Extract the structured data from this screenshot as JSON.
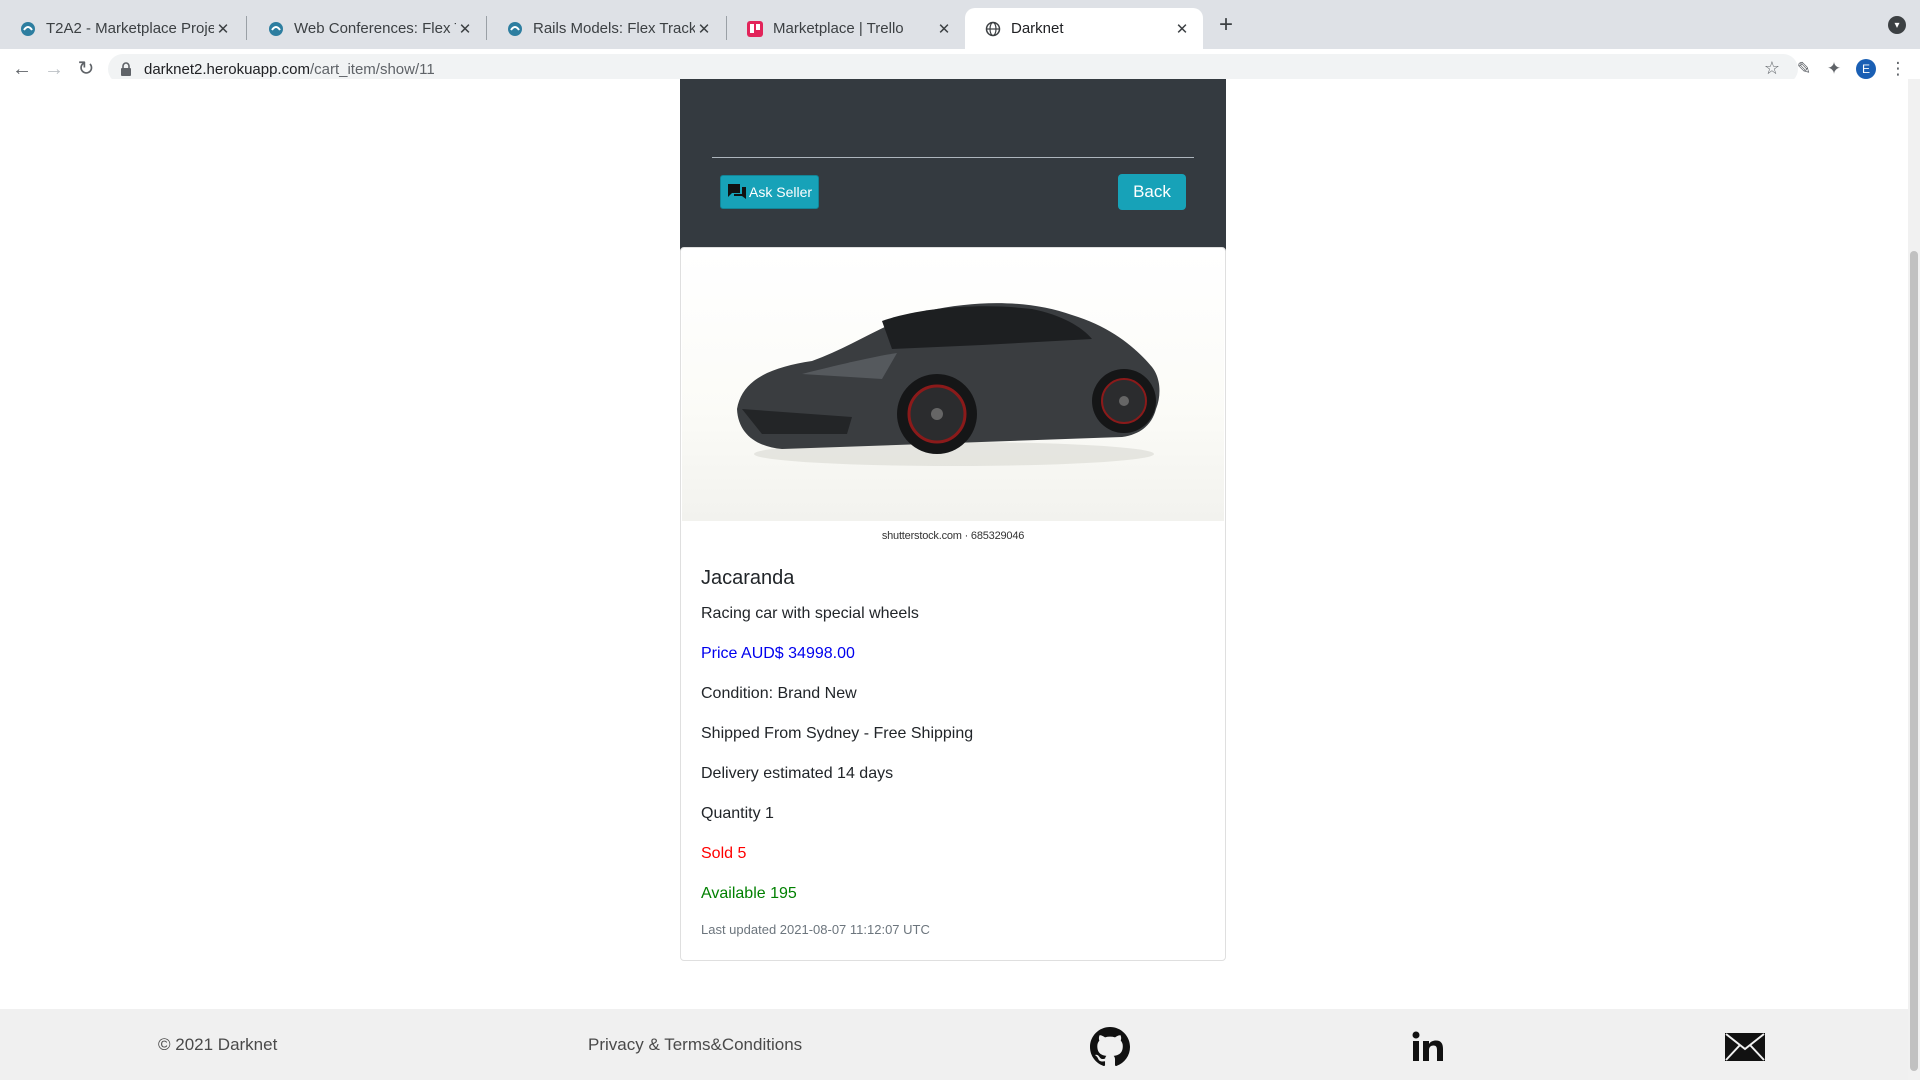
{
  "browser": {
    "tabs": [
      {
        "title": "T2A2 - Marketplace Project",
        "active": false
      },
      {
        "title": "Web Conferences: Flex Track",
        "active": false
      },
      {
        "title": "Rails Models: Flex Track",
        "active": false
      },
      {
        "title": "Marketplace | Trello",
        "active": false
      },
      {
        "title": "Darknet",
        "active": true
      }
    ],
    "url_host": "darknet2.herokuapp.com",
    "url_path": "/cart_item/show/11",
    "profile_initial": "E"
  },
  "actions": {
    "ask_seller_label": "Ask Seller",
    "back_label": "Back"
  },
  "product": {
    "image_watermark": "shutterstock.com · 685329046",
    "name": "Jacaranda",
    "description": "Racing car with special wheels",
    "price": "Price AUD$ 34998.00",
    "condition": "Condition: Brand New",
    "shipping": "Shipped From Sydney - Free Shipping",
    "delivery": "Delivery estimated 14 days",
    "quantity": "Quantity 1",
    "sold": "Sold 5",
    "available": "Available 195",
    "last_updated": "Last updated 2021-08-07 11:12:07 UTC"
  },
  "colors": {
    "price": "#0000ee",
    "sold": "#ff0000",
    "available": "#008000",
    "button": "#17a2b8",
    "dark_card": "#343a40"
  },
  "footer": {
    "copyright": "© 2021 Darknet",
    "privacy": "Privacy & Terms&Conditions",
    "icons": [
      "github-icon",
      "linkedin-icon",
      "mail-icon"
    ]
  }
}
